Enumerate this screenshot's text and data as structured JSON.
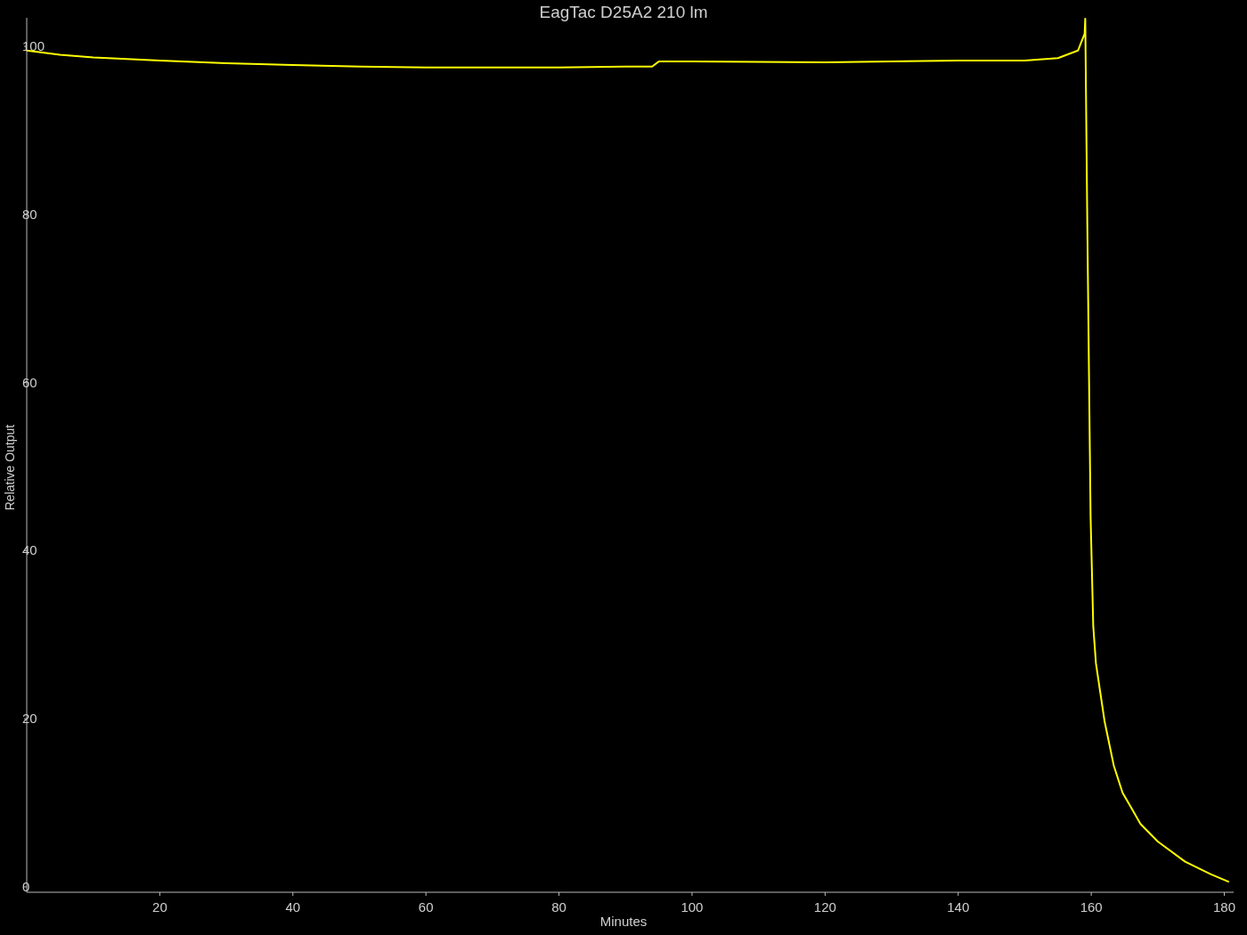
{
  "chart_data": {
    "type": "line",
    "title": "EagTac D25A2 210 lm",
    "xlabel": "Minutes",
    "ylabel": "Relative Output",
    "x": [
      0,
      5,
      10,
      20,
      30,
      40,
      50,
      60,
      70,
      80,
      90,
      94,
      95,
      100,
      120,
      140,
      150,
      155,
      158,
      159,
      159.1,
      159.4,
      159.9,
      160.3,
      160.7,
      162,
      163.4,
      164.7,
      167.4,
      170,
      174.1,
      178,
      180.7
    ],
    "series": [
      {
        "color": "#ffff00",
        "values": [
          99.5,
          99,
          98.7,
          98.3,
          98,
          97.8,
          97.6,
          97.5,
          97.5,
          97.5,
          97.6,
          97.6,
          98.2,
          98.2,
          98.1,
          98.3,
          98.3,
          98.6,
          99.5,
          101.5,
          103.3,
          79,
          44,
          31,
          26.6,
          19.7,
          14.4,
          11.2,
          7.5,
          5.4,
          3,
          1.5,
          0.6
        ]
      }
    ],
    "xlim": [
      0,
      181.4
    ],
    "ylim": [
      -0.64,
      103.4
    ],
    "xticks": [
      20,
      40,
      60,
      80,
      100,
      120,
      140,
      160,
      180
    ],
    "yticks": [
      0,
      20,
      40,
      60,
      80,
      100
    ]
  }
}
